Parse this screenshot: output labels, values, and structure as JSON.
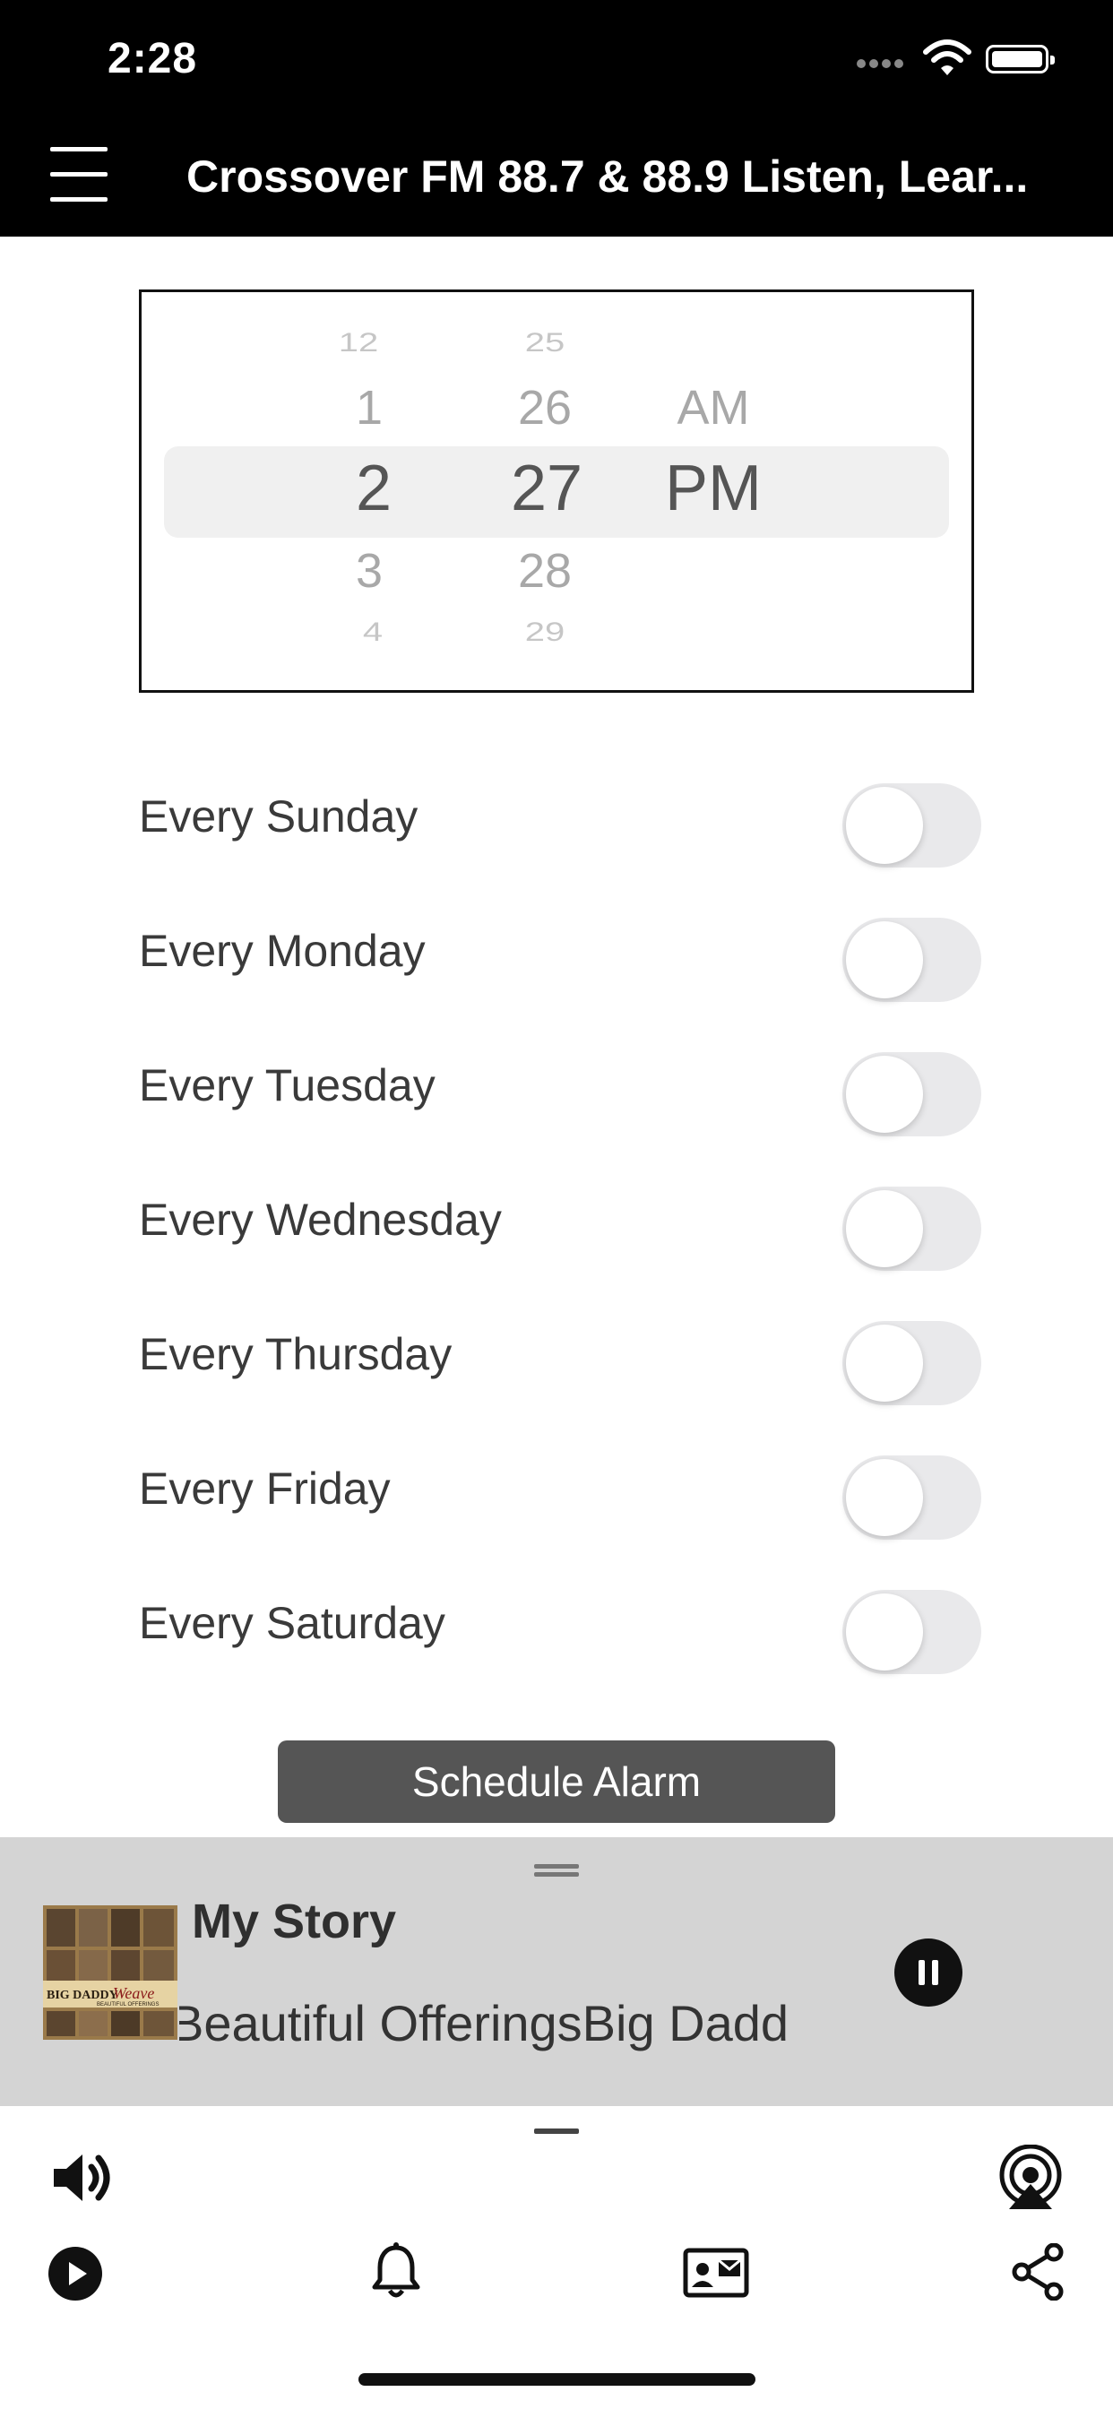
{
  "status_bar": {
    "time": "2:28"
  },
  "nav": {
    "title": "Crossover FM 88.7 & 88.9  Listen, Lear..."
  },
  "picker": {
    "hours": [
      "12",
      "1",
      "2",
      "3",
      "4"
    ],
    "minutes": [
      "25",
      "26",
      "27",
      "28",
      "29"
    ],
    "periods": [
      "AM",
      "PM"
    ],
    "selected": {
      "hour": "2",
      "minute": "27",
      "period": "PM"
    }
  },
  "days": [
    {
      "label": "Every Sunday",
      "enabled": false
    },
    {
      "label": "Every Monday",
      "enabled": false
    },
    {
      "label": "Every Tuesday",
      "enabled": false
    },
    {
      "label": "Every Wednesday",
      "enabled": false
    },
    {
      "label": "Every Thursday",
      "enabled": false
    },
    {
      "label": "Every Friday",
      "enabled": false
    },
    {
      "label": "Every Saturday",
      "enabled": false
    }
  ],
  "schedule_button": {
    "label": "Schedule Alarm"
  },
  "player": {
    "title": "My Story",
    "subtitle": "Beautiful OfferingsBig Dadd",
    "album_art_text": [
      "BIG DADDY",
      "Weave",
      "BEAUTIFUL OFFERINGS"
    ],
    "state": "playing"
  },
  "icons": {
    "menu": "hamburger-icon",
    "volume": "speaker-icon",
    "airplay": "airplay-icon",
    "play": "play-circle-icon",
    "alarm": "bell-icon",
    "contact": "contact-card-icon",
    "share": "share-icon"
  },
  "colors": {
    "nav_bg": "#000000",
    "button_bg": "#555555",
    "player_bg": "#d4d4d4",
    "toggle_off": "#e9e9eb"
  }
}
